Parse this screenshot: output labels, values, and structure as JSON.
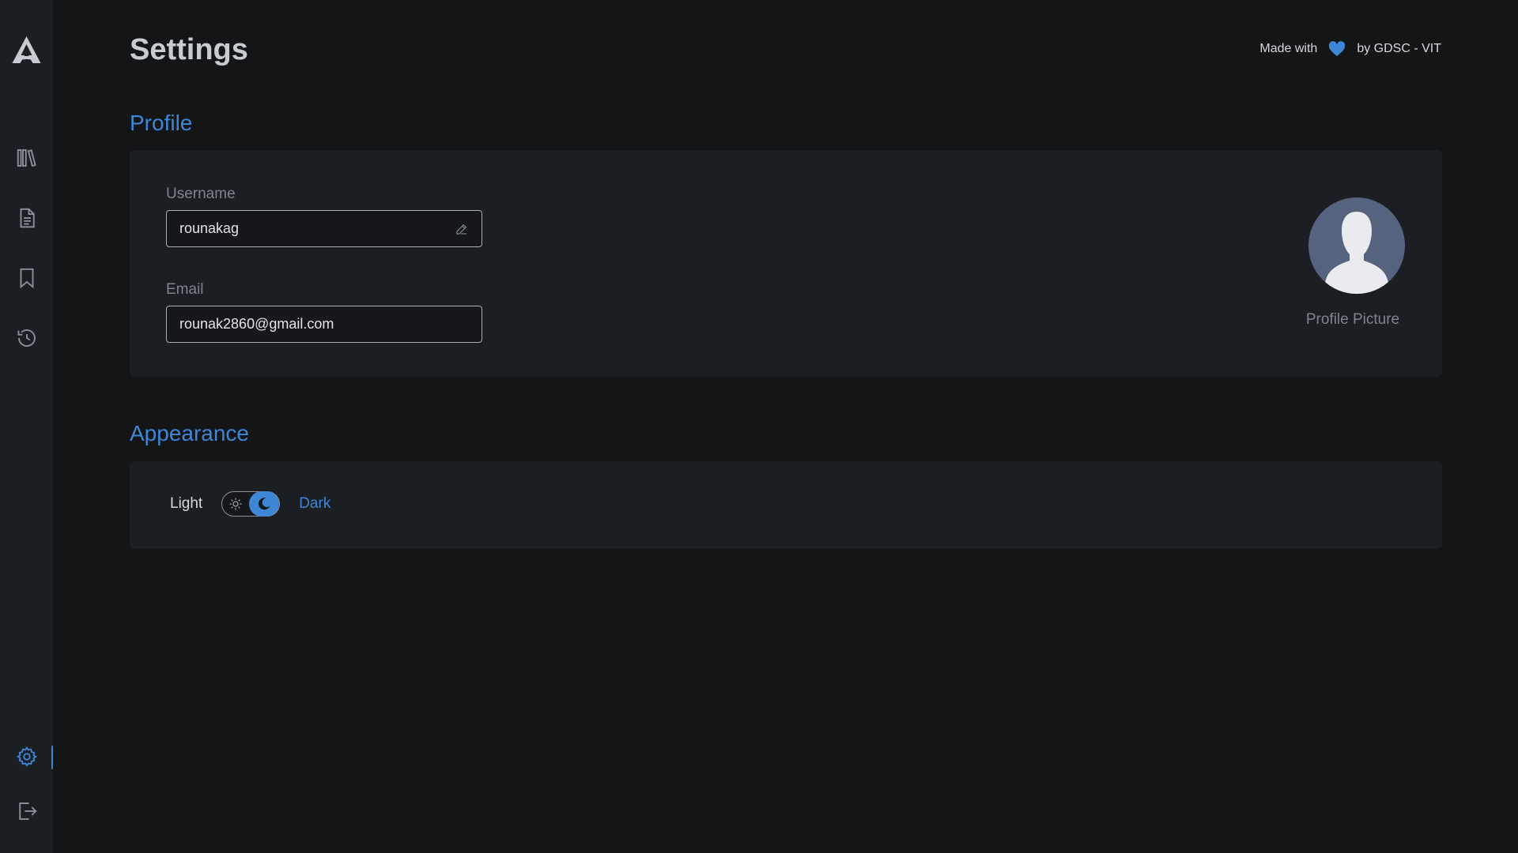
{
  "header": {
    "title": "Settings",
    "made_with_prefix": "Made with",
    "made_with_suffix": "by GDSC - VIT"
  },
  "sidebar": {
    "items": [
      {
        "name": "library",
        "icon": "library-icon"
      },
      {
        "name": "notes",
        "icon": "document-icon"
      },
      {
        "name": "bookmarks",
        "icon": "bookmark-icon"
      },
      {
        "name": "history",
        "icon": "history-icon"
      },
      {
        "name": "settings",
        "icon": "gear-icon",
        "active": true
      },
      {
        "name": "logout",
        "icon": "logout-icon"
      }
    ]
  },
  "profile": {
    "section_title": "Profile",
    "username_label": "Username",
    "username_value": "rounakag",
    "email_label": "Email",
    "email_value": "rounak2860@gmail.com",
    "avatar_label": "Profile Picture"
  },
  "appearance": {
    "section_title": "Appearance",
    "light_label": "Light",
    "dark_label": "Dark",
    "mode": "dark"
  },
  "colors": {
    "accent": "#3e86d6",
    "background": "#131517",
    "card": "#1b1e23"
  }
}
